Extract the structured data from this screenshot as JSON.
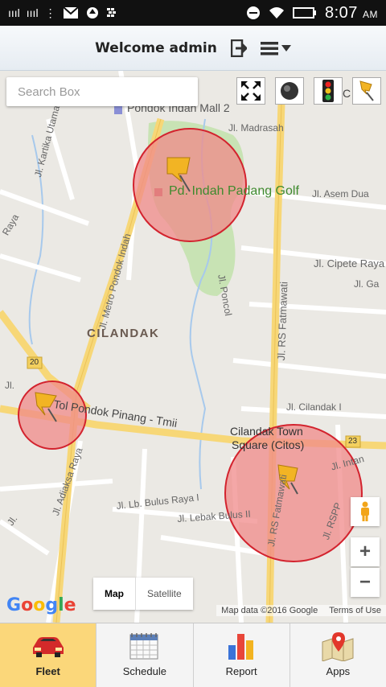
{
  "status_bar": {
    "signal_1": "ıııl",
    "signal_2": "ıııl",
    "time": "8:07",
    "ampm": "AM"
  },
  "header": {
    "title": "Welcome admin",
    "logout_icon": "logout-icon",
    "menu_icon": "hamburger-menu-icon"
  },
  "search": {
    "placeholder": "Search Box",
    "value": ""
  },
  "map_labels": {
    "mall": "Pondok Indah Mall 2",
    "madrasah": "Jl. Madrasah",
    "kartika": "Jl. Kartika Utama",
    "metro": "Jl. Metro Pondok Indah",
    "golf": "Pd. Indah Padang Golf",
    "asem_dua": "Jl. Asem Dua",
    "pkc": "C",
    "poncol": "Jl. Poncol",
    "cipete": "Jl. Cipete Raya",
    "jl_ga": "Jl. Ga",
    "fatmawati": "Jl. RS Fatmawati",
    "cilandak": "CILANDAK",
    "route_20": "20",
    "jl_cilandak": "Jl. Cilandak I",
    "tol": "Tol Pondok Pinang - Tmii",
    "citos_1": "Cilandak Town",
    "citos_2": "Square (Citos)",
    "route_23": "23",
    "adiaksa": "Jl. Adiaksa Raya",
    "intan": "Jl. Intan",
    "bulus_raya": "Jl. Lb. Bulus Raya I",
    "lebak_bulus": "Jl. Lebak Bulus II",
    "fatmawati2": "Jl. RS Fatmawati",
    "rspp": "Jl. RSPP",
    "raya_left": "Raya",
    "jl_left": "Jl.",
    "jl_left2": "Jl."
  },
  "map_controls": {
    "map_type_map": "Map",
    "map_type_satellite": "Satellite",
    "zoom_in": "+",
    "zoom_out": "−",
    "google": "Google",
    "attribution": "Map data ©2016 Google",
    "terms": "Terms of Use"
  },
  "colors": {
    "geofence_fill": "#f08a8a",
    "geofence_stroke": "#d3232e",
    "active_tab": "#fbd77a"
  },
  "bottom_nav": [
    {
      "label": "Fleet",
      "icon": "car-icon",
      "active": true
    },
    {
      "label": "Schedule",
      "icon": "calendar-icon",
      "active": false
    },
    {
      "label": "Report",
      "icon": "bar-chart-icon",
      "active": false
    },
    {
      "label": "Apps",
      "icon": "map-apps-icon",
      "active": false
    }
  ]
}
